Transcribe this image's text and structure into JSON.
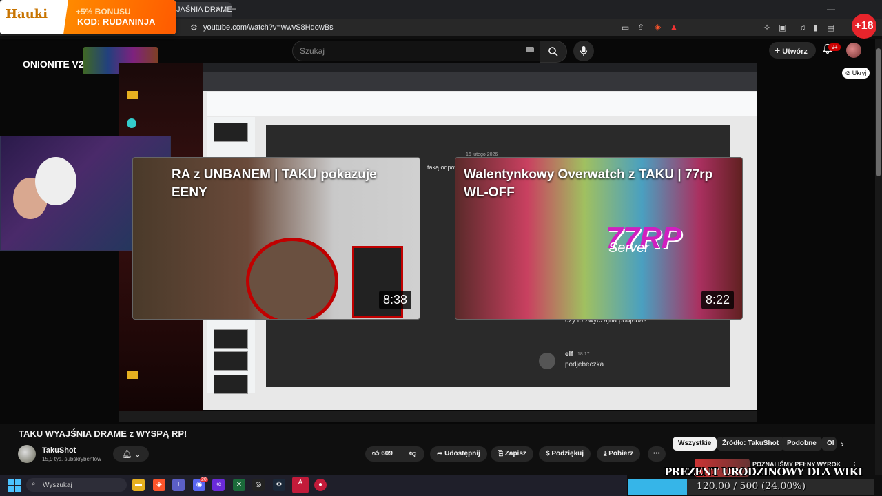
{
  "browser": {
    "active_tab": "JAŚNIA DRAME",
    "url": "youtube.com/watch?v=wwvS8HdowBs"
  },
  "ad_banner": {
    "logo": "Hauki",
    "bonus": "+5% BONUSU",
    "code": "KOD: RUDANINJA"
  },
  "age_badge": "+18",
  "youtube_header": {
    "search_placeholder": "Szukaj",
    "create_label": "Utwórz",
    "notifications_count": "9+",
    "hide_label": "Ukryj"
  },
  "stream": {
    "overlay_label": "ONIONITE V2",
    "slide_date": "16 lutego 2026",
    "slide_text": "taką odpowie",
    "chat_question": "czy to zwyczajna podjeba?",
    "chat_user": "elf",
    "chat_time": "18:17",
    "chat_message": "podjebeczka"
  },
  "end_cards": [
    {
      "title": "RA z UNBANEM | TAKU pokazuje\nEENY",
      "duration": "8:38"
    },
    {
      "title": "Walentynkowy Overwatch z TAKU | 77rp\nWL-OFF",
      "duration": "8:22",
      "logo_text": "77RP",
      "logo_sub": "Server"
    }
  ],
  "video": {
    "title": "TAKU WYAJŚNIA DRAME z WYSPĄ RP!",
    "channel": "TakuShot",
    "subscribers": "15,9 tys. subskrybentów",
    "likes": "609",
    "actions": {
      "share": "Udostępnij",
      "save": "Zapisz",
      "thanks": "Podziękuj",
      "download": "Pobierz"
    }
  },
  "chips": {
    "all": "Wszystkie",
    "source": "Źródło: TakuShot",
    "similar": "Podobne",
    "partial": "Ol"
  },
  "sidebar_video": {
    "title": "POZNALIŚMY PEŁNY WYROK"
  },
  "stream_overlay": {
    "wiki_text": "PREZENT URODZINOWY DLA WIKI",
    "progress_text": "120.00 / 500 (24.00%)",
    "progress_fraction": 0.24
  },
  "taskbar": {
    "search_label": "Wyszukaj",
    "discord_badge": "20"
  },
  "colors": {
    "youtube_bg": "#0f0f0f",
    "accent_red": "#cc0000",
    "progress_fill": "#36b5e8",
    "ad_orange": "#ff7a00"
  }
}
